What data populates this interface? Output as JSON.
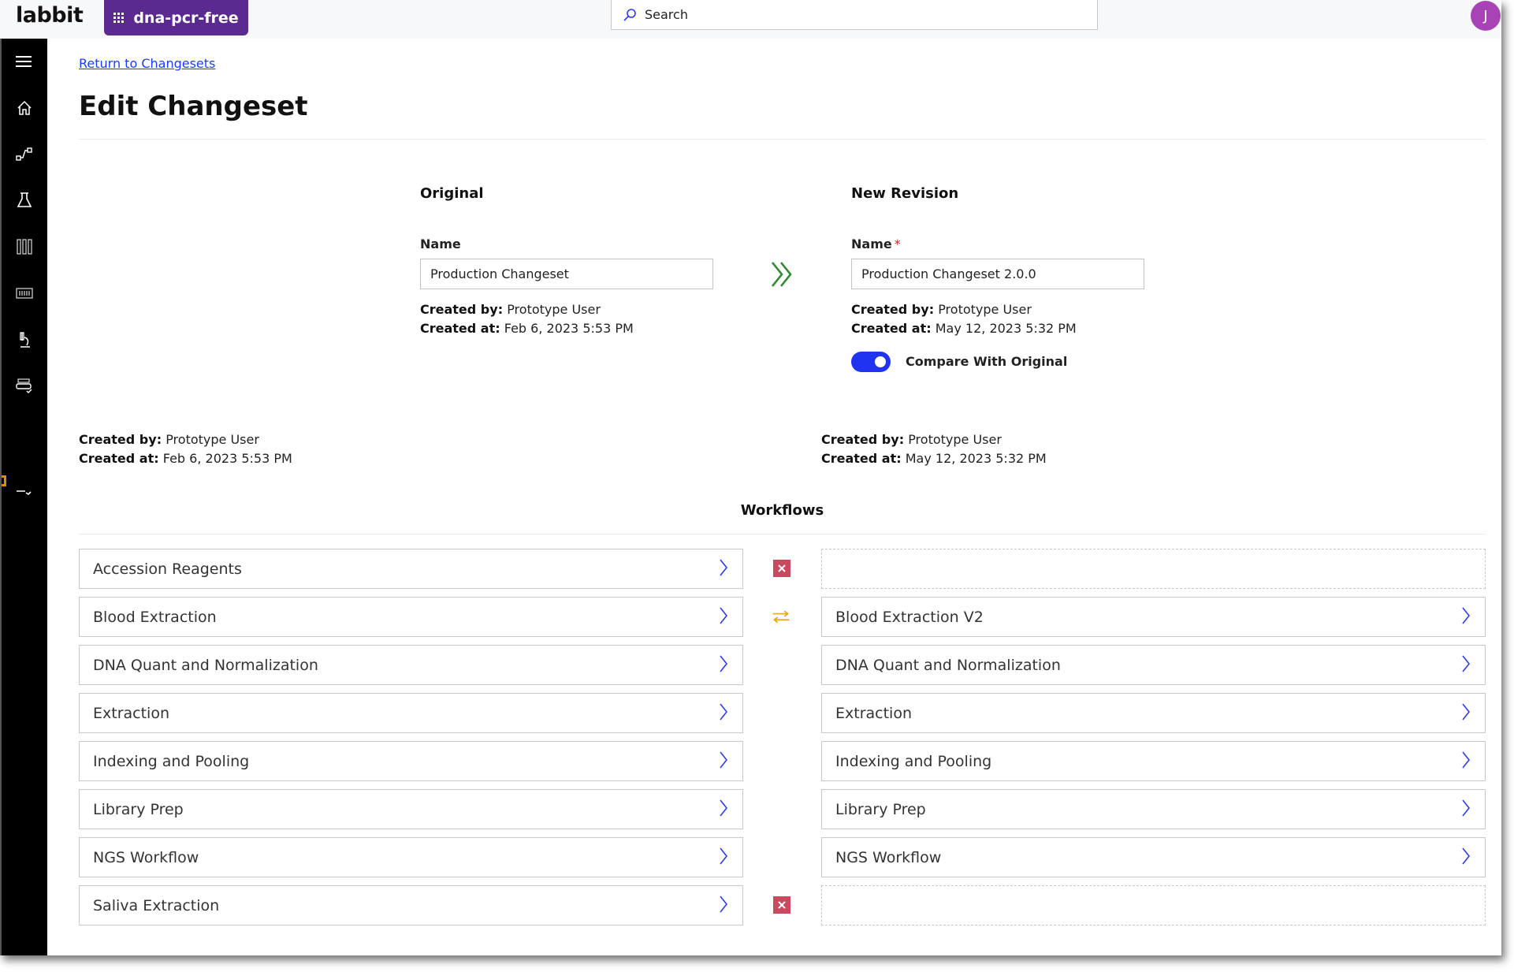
{
  "app": {
    "logo": "labbit",
    "project_button": "dna-pcr-free",
    "search_placeholder": "Search",
    "avatar_initial": "J"
  },
  "sidebar": {
    "items": [
      {
        "icon": "menu-icon"
      },
      {
        "icon": "home-icon"
      },
      {
        "icon": "workflow-icon"
      },
      {
        "icon": "flask-icon"
      },
      {
        "icon": "tubes-icon"
      },
      {
        "icon": "plate-icon"
      },
      {
        "icon": "microscope-icon"
      },
      {
        "icon": "plate-check-icon"
      },
      {
        "icon": "collapse-icon"
      }
    ]
  },
  "page": {
    "back_link": "Return to Changesets",
    "title": "Edit Changeset"
  },
  "original": {
    "heading": "Original",
    "name_label": "Name",
    "name_value": "Production Changeset",
    "created_by_label": "Created by:",
    "created_by": "Prototype User",
    "created_at_label": "Created at:",
    "created_at": "Feb 6, 2023 5:53 PM"
  },
  "revision": {
    "heading": "New Revision",
    "name_label": "Name",
    "required_mark": "*",
    "name_value": "Production Changeset 2.0.0",
    "created_by_label": "Created by:",
    "created_by": "Prototype User",
    "created_at_label": "Created at:",
    "created_at": "May 12, 2023 5:32 PM",
    "compare_label": "Compare With Original",
    "compare_enabled": true
  },
  "summary": {
    "left": {
      "created_by_label": "Created by:",
      "created_by": "Prototype User",
      "created_at_label": "Created at:",
      "created_at": "Feb 6, 2023 5:53 PM"
    },
    "right": {
      "created_by_label": "Created by:",
      "created_by": "Prototype User",
      "created_at_label": "Created at:",
      "created_at": "May 12, 2023 5:32 PM"
    }
  },
  "workflows": {
    "heading": "Workflows",
    "colors": {
      "removed": "#c94a5e",
      "changed": "#e6a817",
      "chevron": "#2a3cf0",
      "arrows": "#2e8b2e"
    },
    "rows": [
      {
        "original": "Accession Reagents",
        "revision": "",
        "status": "removed"
      },
      {
        "original": "Blood Extraction",
        "revision": "Blood Extraction V2",
        "status": "changed"
      },
      {
        "original": "DNA Quant and Normalization",
        "revision": "DNA Quant and Normalization",
        "status": "same"
      },
      {
        "original": "Extraction",
        "revision": "Extraction",
        "status": "same"
      },
      {
        "original": "Indexing and Pooling",
        "revision": "Indexing and Pooling",
        "status": "same"
      },
      {
        "original": "Library Prep",
        "revision": "Library Prep",
        "status": "same"
      },
      {
        "original": "NGS Workflow",
        "revision": "NGS Workflow",
        "status": "same"
      },
      {
        "original": "Saliva Extraction",
        "revision": "",
        "status": "removed"
      }
    ]
  }
}
